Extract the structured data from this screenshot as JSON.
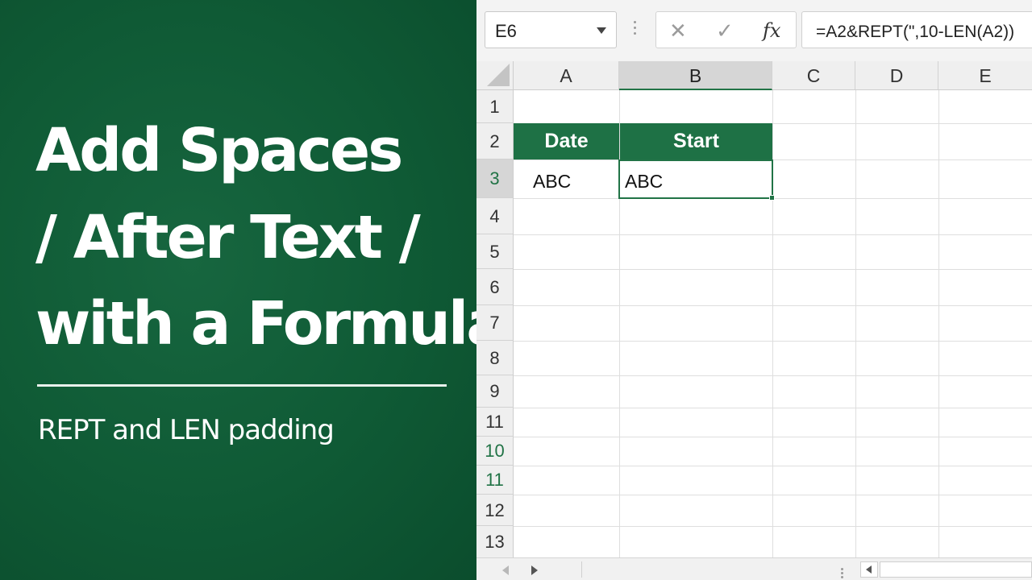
{
  "title_panel": {
    "line1": "Add Spaces",
    "line2": "/ After Text /",
    "line3": "with a Formula",
    "subtitle": "REPT and LEN padding"
  },
  "formula_bar": {
    "name_box": "E6",
    "cancel_icon": "✕",
    "enter_icon": "✓",
    "fx_label": "fx",
    "formula": "=A2&REPT(\",10-LEN(A2))"
  },
  "columns": [
    "A",
    "B",
    "C",
    "D",
    "E"
  ],
  "rows": [
    "1",
    "2",
    "3",
    "4",
    "5",
    "6",
    "7",
    "8",
    "9",
    "11",
    "10",
    "11",
    "12",
    "13"
  ],
  "table": {
    "headers": [
      "Date",
      "Start"
    ],
    "row3": [
      "ABC",
      "ABC"
    ]
  },
  "colors": {
    "panel_green": "#0f5a35",
    "excel_green": "#217346",
    "header_fill": "#1e7145"
  },
  "icons": [
    "name-box-dropdown-icon",
    "cancel-icon",
    "enter-icon",
    "function-icon",
    "sheet-prev-icon",
    "sheet-next-icon",
    "scroll-left-icon"
  ]
}
